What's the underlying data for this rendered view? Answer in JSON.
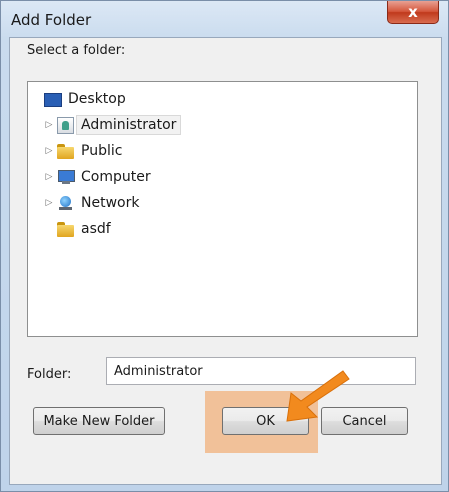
{
  "dialog": {
    "title": "Add Folder",
    "close_glyph": "x"
  },
  "prompt": "Select a folder:",
  "tree": {
    "items": [
      {
        "label": "Desktop",
        "icon": "desktop-icon",
        "expander": "",
        "selected": false
      },
      {
        "label": "Administrator",
        "icon": "user-folder-icon",
        "expander": "▷",
        "selected": true
      },
      {
        "label": "Public",
        "icon": "folder-icon",
        "expander": "▷",
        "selected": false
      },
      {
        "label": "Computer",
        "icon": "computer-icon",
        "expander": "▷",
        "selected": false
      },
      {
        "label": "Network",
        "icon": "network-icon",
        "expander": "▷",
        "selected": false
      },
      {
        "label": "asdf",
        "icon": "folder-icon",
        "expander": "",
        "selected": false
      }
    ]
  },
  "folder_field": {
    "label": "Folder:",
    "value": "Administrator"
  },
  "buttons": {
    "make_new_folder": "Make New Folder",
    "ok": "OK",
    "cancel": "Cancel"
  },
  "colors": {
    "highlight": "#f1b88a",
    "arrow": "#f28a1e"
  }
}
